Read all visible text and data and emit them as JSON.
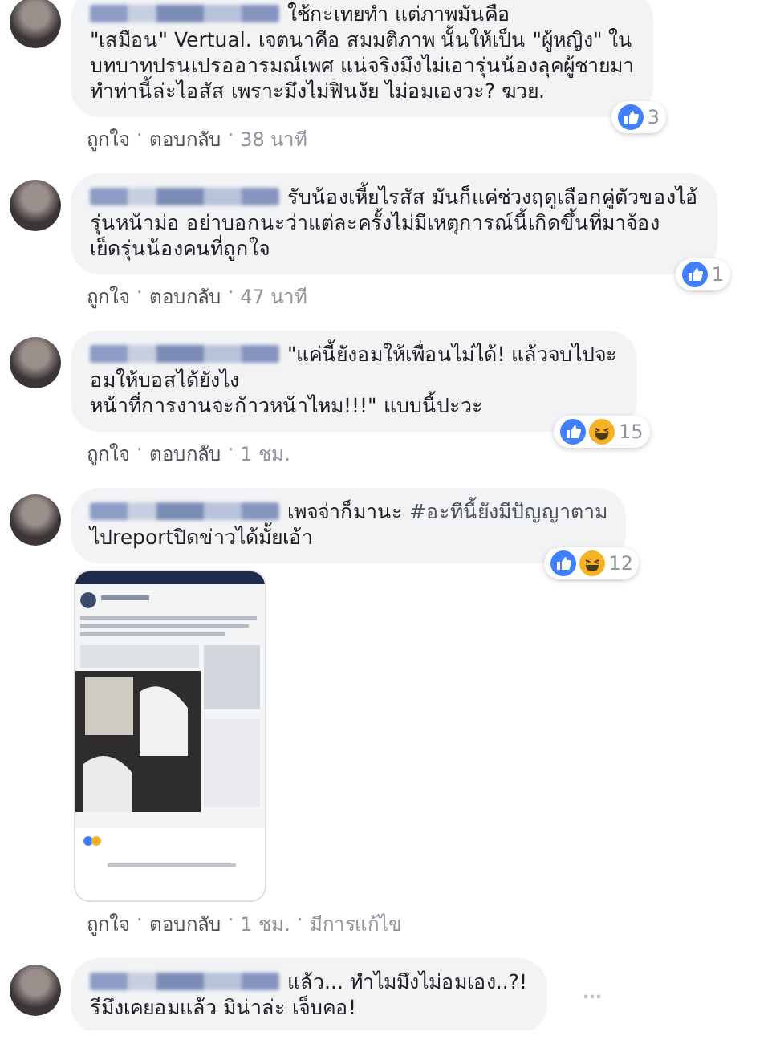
{
  "comments": [
    {
      "lines": [
        [
          {
            "kind": "plain",
            "text": "ใช้กะเทยทำ แต่ภาพมันคือ"
          }
        ],
        [
          {
            "kind": "plain",
            "text": "\"เสมือน\" Vertual. เจตนาคือ สมมติภาพ นั้นให้เป็น \"ผู้หญิง\" ใน"
          }
        ],
        [
          {
            "kind": "plain",
            "text": "บทบาทปรนเปรออารมณ์เพศ แน่จริงมึงไม่เอารุ่นน้องลุคผู้ชายมา"
          }
        ],
        [
          {
            "kind": "plain",
            "text": "ทำท่านี้ล่ะไอสัส เพราะมึงไม่ฟินงัย ไม่อมเองวะ? ฆวย."
          }
        ]
      ],
      "reactions": [
        {
          "kind": "like"
        }
      ],
      "reaction_count": "3",
      "actions": [
        {
          "kind": "like",
          "text": "ถูกใจ"
        },
        {
          "kind": "separator",
          "text": "·"
        },
        {
          "kind": "reply",
          "text": "ตอบกลับ"
        },
        {
          "kind": "separator",
          "text": "·"
        },
        {
          "kind": "time",
          "text": "38 นาที"
        }
      ]
    },
    {
      "lines": [
        [
          {
            "kind": "plain",
            "text": "รับน้องเหี้ยไรสัส มันก็แค่ช่วงฤดูเลือกคู่ตัวของไอ้"
          }
        ],
        [
          {
            "kind": "plain",
            "text": "รุ่นหน้าม่อ อย่าบอกนะว่าแต่ละครั้งไม่มีเหตุการณ์นี้เกิดขึ้นที่มาจ้อง"
          }
        ],
        [
          {
            "kind": "plain",
            "text": "เย็ดรุ่นน้องคนที่ถูกใจ"
          }
        ]
      ],
      "reactions": [
        {
          "kind": "like"
        }
      ],
      "reaction_count": "1",
      "actions": [
        {
          "kind": "like",
          "text": "ถูกใจ"
        },
        {
          "kind": "separator",
          "text": "·"
        },
        {
          "kind": "reply",
          "text": "ตอบกลับ"
        },
        {
          "kind": "separator",
          "text": "·"
        },
        {
          "kind": "time",
          "text": "47 นาที"
        }
      ]
    },
    {
      "lines": [
        [
          {
            "kind": "plain",
            "text": "\"แค่นี้ยังอมให้เพื่อนไม่ได้! แล้วจบไปจะ"
          }
        ],
        [
          {
            "kind": "plain",
            "text": "อมให้บอสได้ยังไง"
          }
        ],
        [
          {
            "kind": "plain",
            "text": "หน้าที่การงานจะก้าวหน้าไหม!!!\" แบบนี้ปะวะ"
          }
        ]
      ],
      "reactions": [
        {
          "kind": "like"
        },
        {
          "kind": "haha"
        }
      ],
      "reaction_count": "15",
      "actions": [
        {
          "kind": "like",
          "text": "ถูกใจ"
        },
        {
          "kind": "separator",
          "text": "·"
        },
        {
          "kind": "reply",
          "text": "ตอบกลับ"
        },
        {
          "kind": "separator",
          "text": "·"
        },
        {
          "kind": "time",
          "text": "1 ชม."
        }
      ]
    },
    {
      "lines": [
        [
          {
            "kind": "plain",
            "text": "เพจจ่าก็มานะ "
          },
          {
            "kind": "hashtag",
            "text": "#อะทีนี้ยังมีปัญญาตาม"
          }
        ],
        [
          {
            "kind": "plain",
            "text": "ไปreportปิดข่าวได้มั้ยเอ้า"
          }
        ]
      ],
      "attachment": {
        "kind": "picture"
      },
      "reactions": [
        {
          "kind": "like"
        },
        {
          "kind": "haha"
        }
      ],
      "reaction_count": "12",
      "actions": [
        {
          "kind": "like",
          "text": "ถูกใจ"
        },
        {
          "kind": "separator",
          "text": "·"
        },
        {
          "kind": "reply",
          "text": "ตอบกลับ"
        },
        {
          "kind": "separator",
          "text": "·"
        },
        {
          "kind": "time",
          "text": "1 ชม."
        },
        {
          "kind": "separator",
          "text": "·"
        },
        {
          "kind": "edited",
          "text": "มีการแก้ไข"
        }
      ]
    },
    {
      "lines": [
        [
          {
            "kind": "plain",
            "text": "แล้ว... ทำไมมึงไม่อมเอง..?!"
          }
        ],
        [
          {
            "kind": "plain",
            "text": "รีมึงเคยอมแล้ว มิน่าล่ะ เจ็บคอ!"
          }
        ]
      ],
      "more_menu": true
    }
  ]
}
